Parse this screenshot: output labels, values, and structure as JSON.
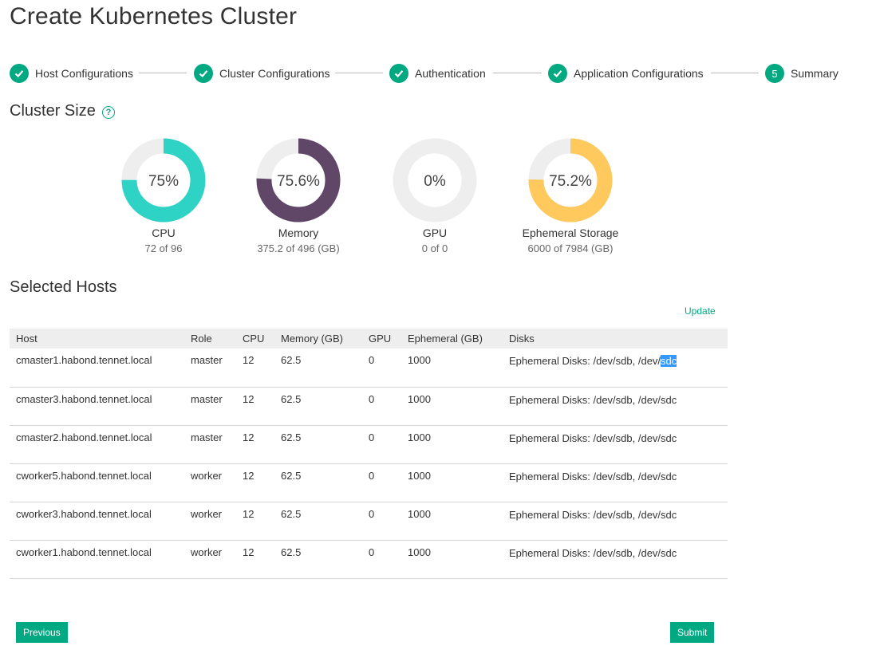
{
  "page": {
    "title": "Create Kubernetes Cluster"
  },
  "stepper": {
    "steps": [
      {
        "label": "Host Configurations",
        "state": "done"
      },
      {
        "label": "Cluster Configurations",
        "state": "done"
      },
      {
        "label": "Authentication",
        "state": "done"
      },
      {
        "label": "Application Configurations",
        "state": "done"
      },
      {
        "label": "Summary",
        "number": "5",
        "state": "current"
      }
    ]
  },
  "cluster_size": {
    "title": "Cluster Size",
    "help_icon": "question-circle-icon",
    "gauges": [
      {
        "name": "CPU",
        "percent_label": "75%",
        "fraction": 0.75,
        "detail": "72 of 96",
        "color": "#2ed3c6"
      },
      {
        "name": "Memory",
        "percent_label": "75.6%",
        "fraction": 0.756,
        "detail": "375.2 of 496 (GB)",
        "color": "#614767"
      },
      {
        "name": "GPU",
        "percent_label": "0%",
        "fraction": 0.0,
        "detail": "0 of 0",
        "color": "#cccccc"
      },
      {
        "name": "Ephemeral Storage",
        "percent_label": "75.2%",
        "fraction": 0.752,
        "detail": "6000 of 7984 (GB)",
        "color": "#ffc95e"
      }
    ],
    "track_color": "#eeeeee"
  },
  "selected_hosts": {
    "title": "Selected Hosts",
    "update_label": "Update",
    "columns": [
      "Host",
      "Role",
      "CPU",
      "Memory (GB)",
      "GPU",
      "Ephemeral (GB)",
      "Disks"
    ],
    "rows": [
      {
        "host": "cmaster1.habond.tennet.local",
        "role": "master",
        "cpu": "12",
        "memory": "62.5",
        "gpu": "0",
        "ephemeral": "1000",
        "disks_prefix": "Ephemeral Disks: /dev/sdb, /dev/",
        "disks_selected": "sdc",
        "disks_suffix": ""
      },
      {
        "host": "cmaster3.habond.tennet.local",
        "role": "master",
        "cpu": "12",
        "memory": "62.5",
        "gpu": "0",
        "ephemeral": "1000",
        "disks_prefix": "Ephemeral Disks: /dev/sdb, /dev/sdc",
        "disks_selected": "",
        "disks_suffix": ""
      },
      {
        "host": "cmaster2.habond.tennet.local",
        "role": "master",
        "cpu": "12",
        "memory": "62.5",
        "gpu": "0",
        "ephemeral": "1000",
        "disks_prefix": "Ephemeral Disks: /dev/sdb, /dev/sdc",
        "disks_selected": "",
        "disks_suffix": ""
      },
      {
        "host": "cworker5.habond.tennet.local",
        "role": "worker",
        "cpu": "12",
        "memory": "62.5",
        "gpu": "0",
        "ephemeral": "1000",
        "disks_prefix": "Ephemeral Disks: /dev/sdb, /dev/sdc",
        "disks_selected": "",
        "disks_suffix": ""
      },
      {
        "host": "cworker3.habond.tennet.local",
        "role": "worker",
        "cpu": "12",
        "memory": "62.5",
        "gpu": "0",
        "ephemeral": "1000",
        "disks_prefix": "Ephemeral Disks: /dev/sdb, /dev/sdc",
        "disks_selected": "",
        "disks_suffix": ""
      },
      {
        "host": "cworker1.habond.tennet.local",
        "role": "worker",
        "cpu": "12",
        "memory": "62.5",
        "gpu": "0",
        "ephemeral": "1000",
        "disks_prefix": "Ephemeral Disks: /dev/sdb, /dev/sdc",
        "disks_selected": "",
        "disks_suffix": ""
      }
    ]
  },
  "footer": {
    "previous_label": "Previous",
    "submit_label": "Submit"
  },
  "colors": {
    "accent": "#01a982",
    "selection": "#3399ff"
  }
}
